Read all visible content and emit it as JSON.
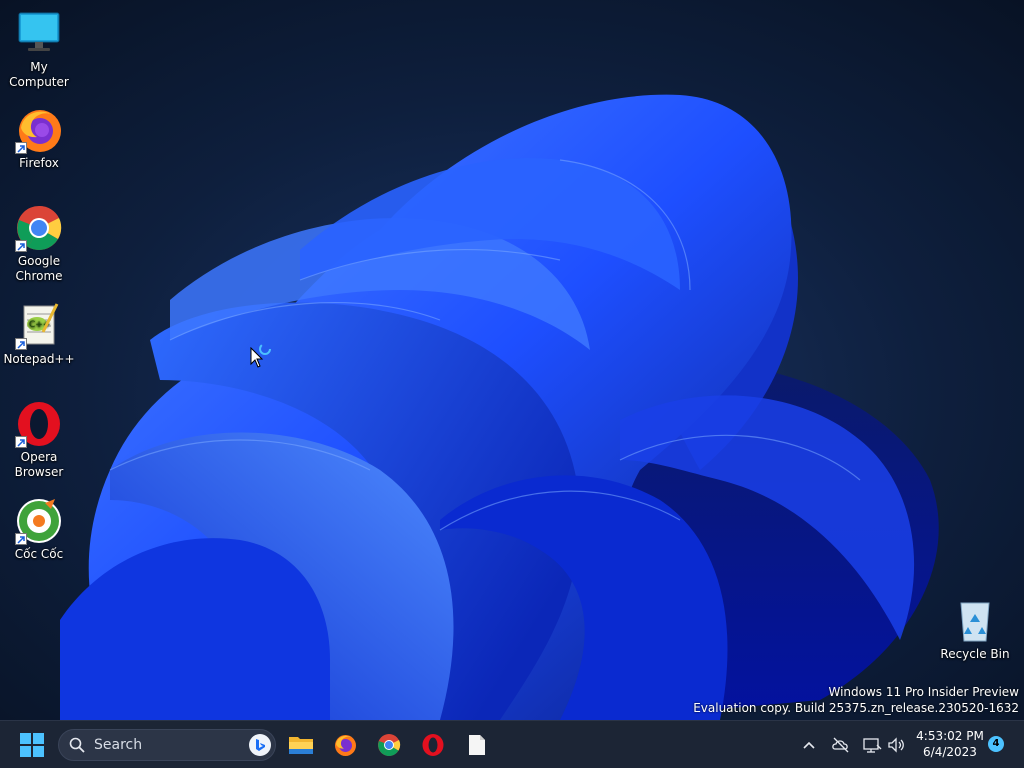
{
  "desktop": {
    "icons": [
      {
        "label": "My Computer",
        "icon": "monitor-icon"
      },
      {
        "label": "Firefox",
        "icon": "firefox-icon"
      },
      {
        "label": "Google Chrome",
        "icon": "chrome-icon"
      },
      {
        "label": "Notepad++",
        "icon": "notepadpp-icon"
      },
      {
        "label": "Opera Browser",
        "icon": "opera-icon"
      },
      {
        "label": "Cốc Cốc",
        "icon": "coccoc-icon"
      }
    ],
    "recycle_bin": {
      "label": "Recycle Bin",
      "icon": "recycle-bin-icon"
    }
  },
  "watermark": {
    "line1": "Windows 11 Pro Insider Preview",
    "line2": "Evaluation copy. Build 25375.zn_release.230520-1632"
  },
  "taskbar": {
    "search": {
      "placeholder": "Search"
    },
    "pinned": [
      "file-explorer-icon",
      "firefox-icon",
      "chrome-icon",
      "opera-icon",
      "blank-document-icon"
    ],
    "tray": {
      "time": "4:53:02 PM",
      "date": "6/4/2023",
      "notification_count": "4"
    }
  },
  "colors": {
    "accent": "#4cc2ff",
    "wallpaper_dark": "#0b1830",
    "bloom_blue": "#1e4fff",
    "taskbar": "#1c2535"
  }
}
